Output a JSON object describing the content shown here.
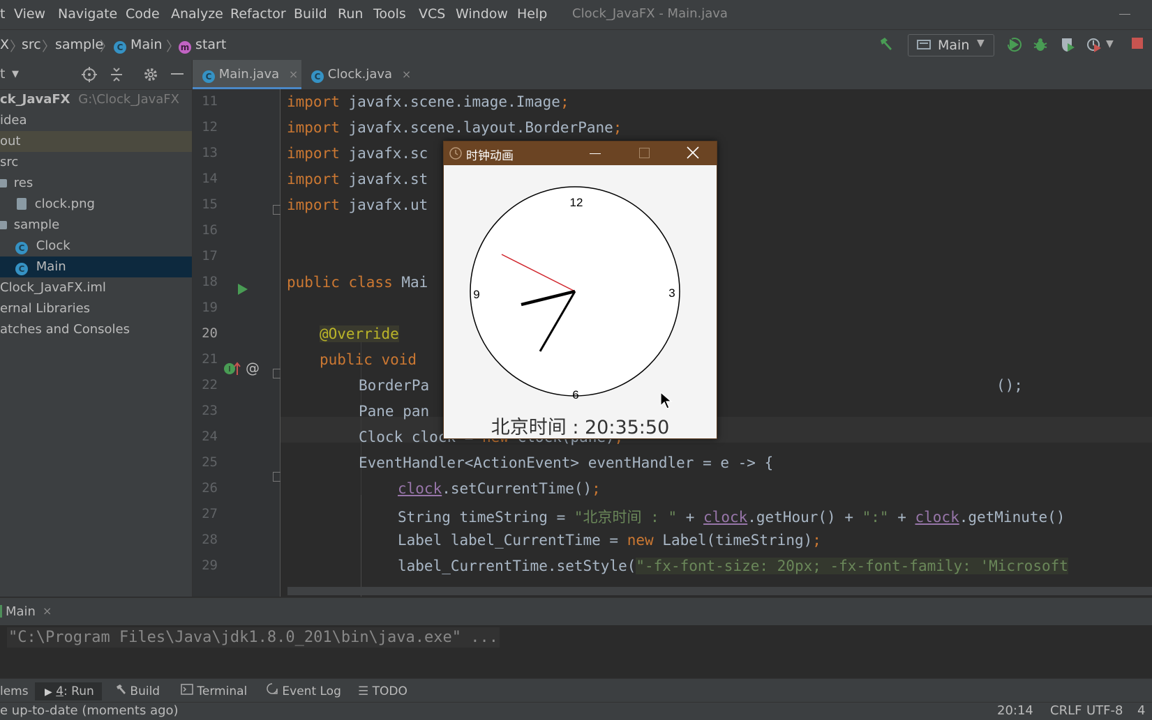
{
  "menu": {
    "items": [
      "t",
      "View",
      "Navigate",
      "Code",
      "Analyze",
      "Refactor",
      "Build",
      "Run",
      "Tools",
      "VCS",
      "Window",
      "Help"
    ],
    "window_title": "Clock_JavaFX - Main.java"
  },
  "navbar": {
    "breadcrumbs": [
      "X",
      "src",
      "sample",
      "Main",
      "start"
    ],
    "run_config": "Main"
  },
  "project": {
    "header_label": "t",
    "tree": [
      {
        "label": "ck_JavaFX",
        "extra": "G:\\Clock_JavaFX"
      },
      {
        "label": "idea"
      },
      {
        "label": "out"
      },
      {
        "label": "src"
      },
      {
        "label": "res"
      },
      {
        "label": "clock.png"
      },
      {
        "label": "sample"
      },
      {
        "label": "Clock"
      },
      {
        "label": "Main"
      },
      {
        "label": "Clock_JavaFX.iml"
      },
      {
        "label": "ernal Libraries"
      },
      {
        "label": "atches and Consoles"
      }
    ]
  },
  "editor": {
    "tabs": [
      {
        "label": "Main.java",
        "close": "×"
      },
      {
        "label": "Clock.java",
        "close": "×"
      }
    ],
    "line_numbers": [
      "11",
      "12",
      "13",
      "14",
      "15",
      "16",
      "17",
      "18",
      "19",
      "20",
      "21",
      "22",
      "23",
      "24",
      "25",
      "26",
      "27",
      "28",
      "29"
    ],
    "code": {
      "l11_kw": "import",
      "l11_rest": " javafx.scene.image.Image",
      "l11_semi": ";",
      "l12_kw": "import",
      "l12_rest": " javafx.scene.layout.BorderPane",
      "l12_semi": ";",
      "l13_kw": "import",
      "l13_rest": " javafx.sc",
      "l14_kw": "import",
      "l14_rest": " javafx.st",
      "l15_kw": "import",
      "l15_rest": " javafx.ut",
      "l18_kw": "public class",
      "l18_rest": " Mai",
      "l20_ann": "@Override",
      "l21_kw": "public void",
      "l22_rest": "BorderPa",
      "l22_tail": "();",
      "l23_rest": "Pane pan",
      "l24_a": "Clock clock = ",
      "l24_kw": "new",
      "l24_b": " Clock(pane)",
      "l24_semi": ";",
      "l25_rest": "EventHandler<ActionEvent> eventHandler = e -> {",
      "l26_field": "clock",
      "l26_rest": ".setCurrentTime()",
      "l26_semi": ";",
      "l27_a": "String timeString = ",
      "l27_str": "\"北京时间 : \"",
      "l27_b": " + ",
      "l27_f1": "clock",
      "l27_c": ".getHour() + ",
      "l27_str2": "\":\"",
      "l27_d": " + ",
      "l27_f2": "clock",
      "l27_e": ".getMinute()",
      "l28_a": "Label label_CurrentTime = ",
      "l28_kw": "new",
      "l28_b": " Label(timeString)",
      "l28_semi": ";",
      "l29_a": "label_CurrentTime.setStyle(",
      "l29_str": "\"-fx-font-size: 20px; -fx-font-family: 'Microsoft"
    }
  },
  "clock_window": {
    "title": "时钟动画",
    "numbers": {
      "top": "12",
      "right": "3",
      "bottom": "6",
      "left": "9"
    },
    "time_label": "北京时间 : 20:35:50"
  },
  "run_panel": {
    "tab_label": "Main",
    "tab_close": "×",
    "command": "\"C:\\Program Files\\Java\\jdk1.8.0_201\\bin\\java.exe\" ..."
  },
  "toolwindows": {
    "items": [
      {
        "label": "lems"
      },
      {
        "label_prefix": "4",
        "label": ": Run"
      },
      {
        "label": "Build"
      },
      {
        "label": "Terminal"
      },
      {
        "label": "Event Log"
      },
      {
        "label": "TODO"
      }
    ]
  },
  "status": {
    "message": "e up-to-date (moments ago)",
    "position": "20:14",
    "line_sep": "CRLF",
    "encoding": "UTF-8",
    "indent": "4"
  },
  "colors": {
    "keyword": "#cc7832",
    "annotation": "#bbb529",
    "string": "#6a8759",
    "field": "#9876aa",
    "run_green": "#499c54",
    "stop_red": "#c75450",
    "clock_second_hand": "#d0232a"
  }
}
